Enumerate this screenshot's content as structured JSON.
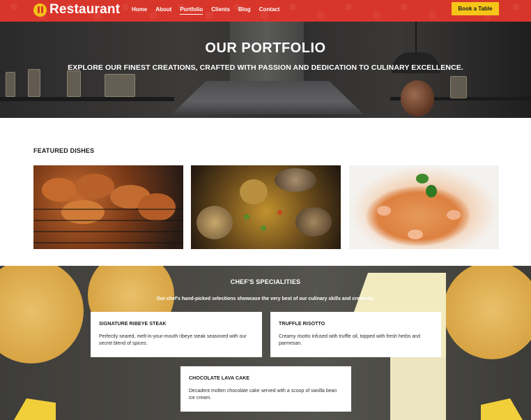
{
  "nav": {
    "logo_text": "Restaurant",
    "links": [
      "Home",
      "About",
      "Portfolio",
      "Clients",
      "Blog",
      "Contact"
    ],
    "active_link": "Portfolio",
    "cta_label": "Book a Table"
  },
  "hero": {
    "title": "OUR PORTFOLIO",
    "subtitle": "EXPLORE OUR FINEST CREATIONS, CRAFTED WITH PASSION AND DEDICATION TO CULINARY EXCELLENCE."
  },
  "featured": {
    "heading": "FEATURED DISHES"
  },
  "specialities": {
    "heading": "CHEF'S SPECIALITIES",
    "subtitle": "Our chef's hand-picked selections showcase the very best of our culinary skills and creativity.",
    "cards": [
      {
        "title": "SIGNATURE RIBEYE STEAK",
        "text": "Perfectly seared, melt-in-your-mouth ribeye steak seasoned with our secret blend of spices."
      },
      {
        "title": "TRUFFLE RISOTTO",
        "text": "Creamy risotto infused with truffle oil, topped with fresh herbs and parmesan."
      },
      {
        "title": "CHOCOLATE LAVA CAKE",
        "text": "Decadent molten chocolate cake served with a scoop of vanilla bean ice cream."
      }
    ]
  },
  "colors": {
    "brand_red": "#d9362b",
    "accent_yellow": "#f6c518",
    "icons": [
      "fork-knife-icon"
    ]
  }
}
